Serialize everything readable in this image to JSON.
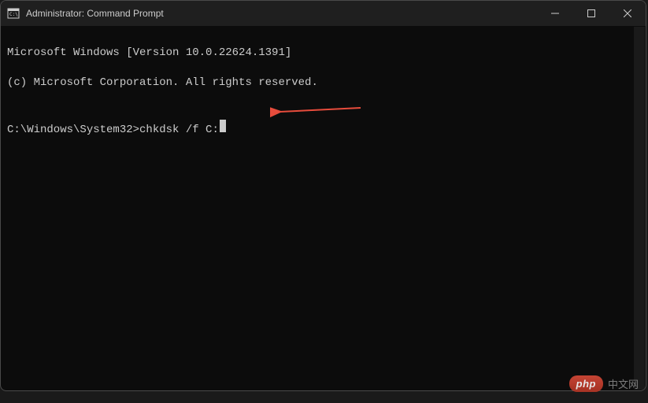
{
  "window": {
    "title": "Administrator: Command Prompt"
  },
  "terminal": {
    "line1": "Microsoft Windows [Version 10.0.22624.1391]",
    "line2": "(c) Microsoft Corporation. All rights reserved.",
    "blank": "",
    "prompt": "C:\\Windows\\System32>",
    "command": "chkdsk /f C:"
  },
  "watermark": {
    "badge": "php",
    "text": "中文网"
  }
}
